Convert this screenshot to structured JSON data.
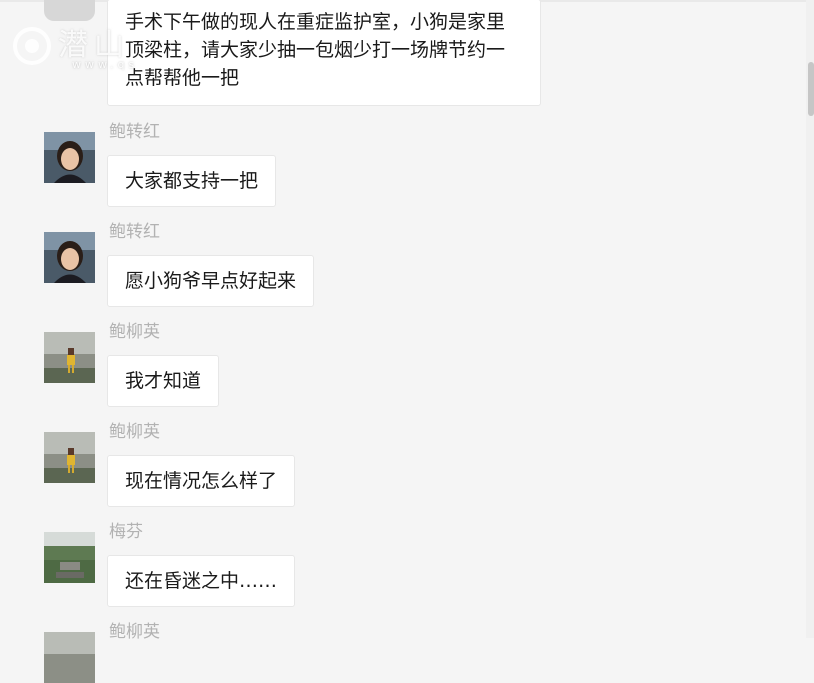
{
  "watermark": {
    "text": "潜山",
    "sub": "www.qs"
  },
  "top_message": {
    "text": "手术下午做的现人在重症监护室，小狗是家里顶梁柱，请大家少抽一包烟少打一场牌节约一点帮帮他一把"
  },
  "messages": [
    {
      "sender": "鲍转红",
      "text": "大家都支持一把",
      "avatar": "woman-portrait"
    },
    {
      "sender": "鲍转红",
      "text": "愿小狗爷早点好起来",
      "avatar": "woman-portrait"
    },
    {
      "sender": "鲍柳英",
      "text": "我才知道",
      "avatar": "mountain-person"
    },
    {
      "sender": "鲍柳英",
      "text": "现在情况怎么样了",
      "avatar": "mountain-person"
    },
    {
      "sender": "梅芬",
      "text": "还在昏迷之中……",
      "avatar": "landscape"
    },
    {
      "sender": "鲍柳英",
      "text": "",
      "avatar": "mountain-person"
    }
  ]
}
